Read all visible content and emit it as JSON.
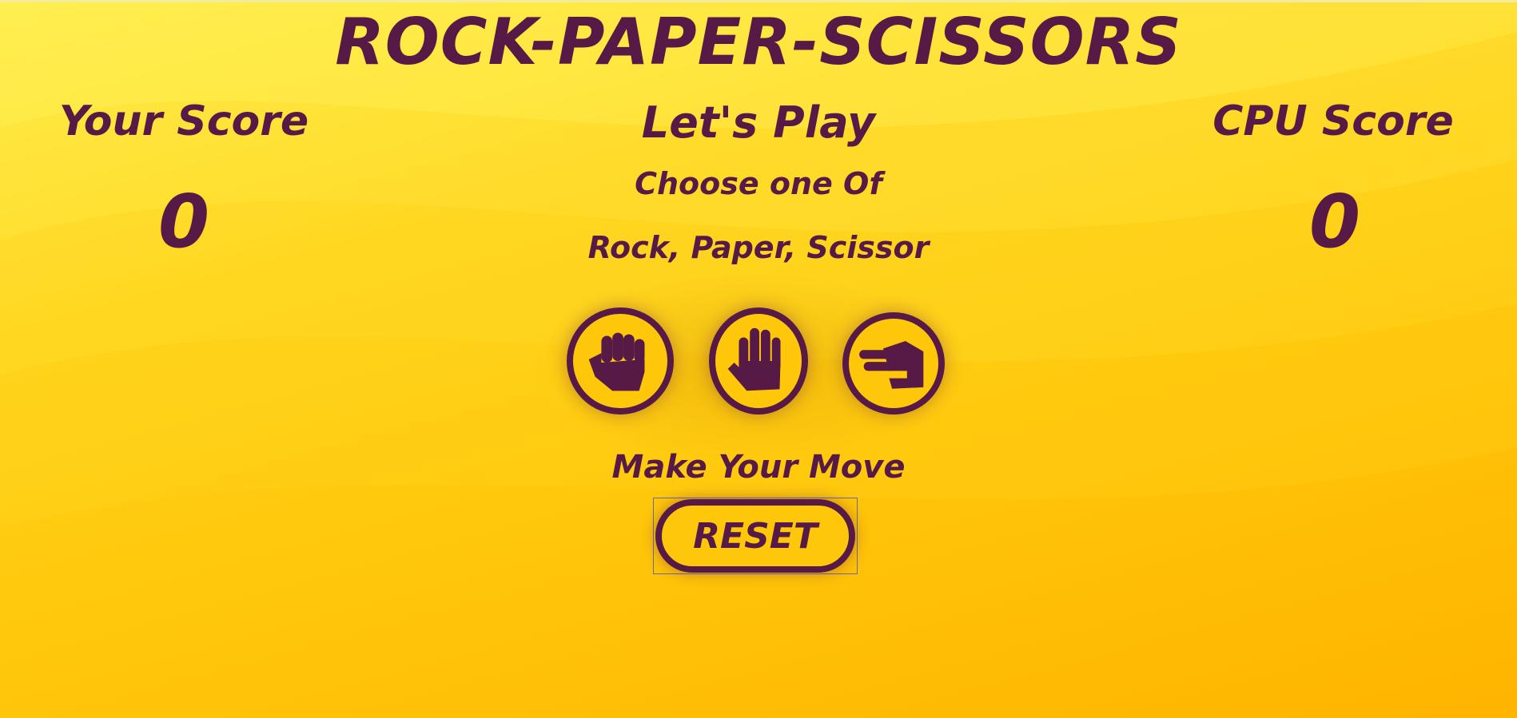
{
  "game": {
    "title": "ROCK-PAPER-SCISSORS",
    "player": {
      "label": "Your Score",
      "score": "0"
    },
    "cpu": {
      "label": "CPU Score",
      "score": "0"
    },
    "prompt": {
      "heading": "Let's Play",
      "line1": "Choose one Of",
      "line2": "Rock, Paper, Scissor"
    },
    "choices": [
      {
        "name": "rock",
        "icon": "hand-rock-icon"
      },
      {
        "name": "paper",
        "icon": "hand-paper-icon"
      },
      {
        "name": "scissors",
        "icon": "hand-scissors-icon"
      }
    ],
    "status": "Make Your Move",
    "reset_label": "RESET"
  },
  "colors": {
    "primary": "#571a46",
    "background_top": "#ffec4a",
    "background_bottom": "#ffb400"
  }
}
